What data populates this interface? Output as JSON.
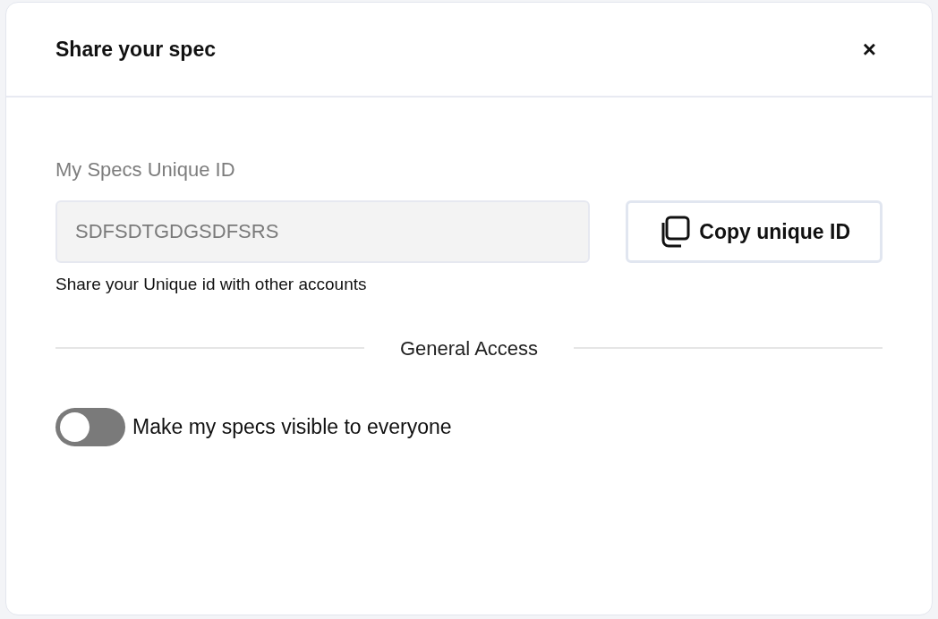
{
  "dialog": {
    "title": "Share your spec",
    "close": "×"
  },
  "unique_id": {
    "label": "My Specs Unique ID",
    "value": "SDFSDTGDGSDFSRS",
    "copy_button": "Copy unique ID",
    "hint": "Share your Unique id with other accounts"
  },
  "section_title": "General Access",
  "visibility_toggle": {
    "on": false,
    "label": "Make my specs visible to everyone"
  }
}
